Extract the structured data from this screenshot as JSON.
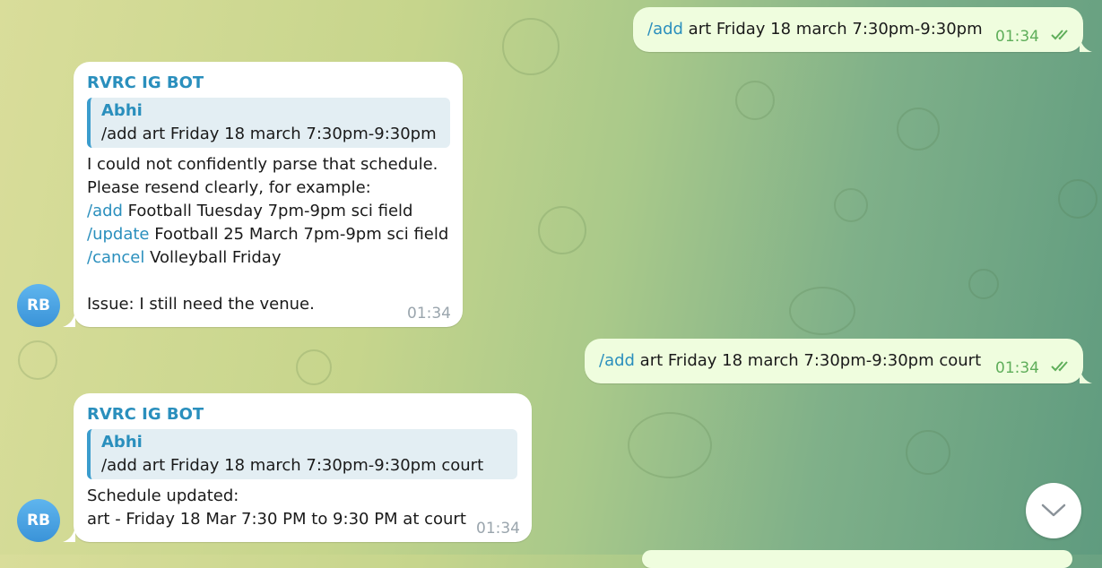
{
  "messages": [
    {
      "type": "outgoing",
      "command": "/add",
      "text": " art Friday 18 march 7:30pm-9:30pm",
      "time": "01:34"
    },
    {
      "type": "incoming",
      "sender": "RVRC IG BOT",
      "avatar": "RB",
      "reply_to": {
        "name": "Abhi",
        "text": "/add art Friday 18 march 7:30pm-9:30pm"
      },
      "lines": [
        "I could not confidently parse that schedule.",
        "Please resend clearly, for example:"
      ],
      "examples": [
        {
          "command": "/add",
          "text": " Football Tuesday 7pm-9pm sci field"
        },
        {
          "command": "/update",
          "text": " Football 25 March 7pm-9pm sci field"
        },
        {
          "command": "/cancel",
          "text": " Volleyball Friday"
        }
      ],
      "issue": "Issue: I still need the venue.",
      "time": "01:34"
    },
    {
      "type": "outgoing",
      "command": "/add",
      "text": " art Friday 18 march 7:30pm-9:30pm court",
      "time": "01:34"
    },
    {
      "type": "incoming",
      "sender": "RVRC IG BOT",
      "avatar": "RB",
      "reply_to": {
        "name": "Abhi",
        "text": "/add art Friday 18 march 7:30pm-9:30pm court"
      },
      "lines": [
        "Schedule updated:",
        "art - Friday 18 Mar 7:30 PM to 9:30 PM at court"
      ],
      "time": "01:34"
    }
  ],
  "icons": {
    "read_receipt": "double-check-icon",
    "scroll_down": "chevron-down-icon"
  },
  "colors": {
    "outgoing_bubble": "#effdde",
    "incoming_bubble": "#ffffff",
    "link": "#2a8fbd",
    "avatar": "#3a93d8"
  }
}
